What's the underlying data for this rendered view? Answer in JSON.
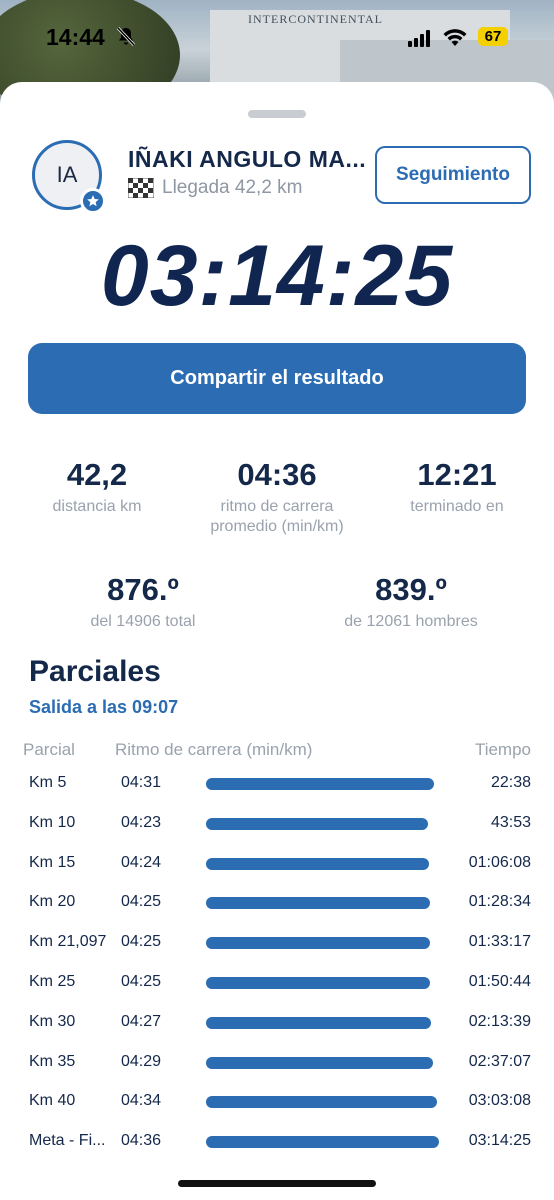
{
  "status_bar": {
    "time": "14:44",
    "battery": "67"
  },
  "background": {
    "sign_text": "INTERCONTINENTAL"
  },
  "runner": {
    "initials": "IA",
    "name": "IÑAKI ANGULO MA...",
    "finish_label": "Llegada 42,2 km",
    "follow_label": "Seguimiento"
  },
  "result": {
    "finish_time": "03:14:25",
    "share_label": "Compartir el resultado"
  },
  "stats": [
    {
      "value": "42,2",
      "label": "distancia km"
    },
    {
      "value": "04:36",
      "label": "ritmo de carrera promedio (min/km)"
    },
    {
      "value": "12:21",
      "label": "terminado en"
    }
  ],
  "rankings": [
    {
      "value": "876.º",
      "label": "del 14906 total"
    },
    {
      "value": "839.º",
      "label": "de 12061 hombres"
    }
  ],
  "splits": {
    "title": "Parciales",
    "start": "Salida a las 09:07",
    "headers": {
      "split": "Parcial",
      "pace": "Ritmo de carrera (min/km)",
      "time": "Tiempo"
    },
    "rows": [
      {
        "split": "Km 5",
        "pace": "04:31",
        "pace_fraction": 0.98,
        "time": "22:38"
      },
      {
        "split": "Km 10",
        "pace": "04:23",
        "pace_fraction": 0.953,
        "time": "43:53"
      },
      {
        "split": "Km 15",
        "pace": "04:24",
        "pace_fraction": 0.957,
        "time": "01:06:08"
      },
      {
        "split": "Km 20",
        "pace": "04:25",
        "pace_fraction": 0.96,
        "time": "01:28:34"
      },
      {
        "split": "Km 21,097",
        "pace": "04:25",
        "pace_fraction": 0.96,
        "time": "01:33:17"
      },
      {
        "split": "Km 25",
        "pace": "04:25",
        "pace_fraction": 0.96,
        "time": "01:50:44"
      },
      {
        "split": "Km 30",
        "pace": "04:27",
        "pace_fraction": 0.967,
        "time": "02:13:39"
      },
      {
        "split": "Km 35",
        "pace": "04:29",
        "pace_fraction": 0.975,
        "time": "02:37:07"
      },
      {
        "split": "Km 40",
        "pace": "04:34",
        "pace_fraction": 0.993,
        "time": "03:03:08"
      },
      {
        "split": "Meta - Fi...",
        "pace": "04:36",
        "pace_fraction": 1.0,
        "time": "03:14:25"
      }
    ]
  },
  "colors": {
    "accent": "#2b6cb3",
    "text_dark": "#14284a",
    "text_muted": "#9aa2ad"
  }
}
